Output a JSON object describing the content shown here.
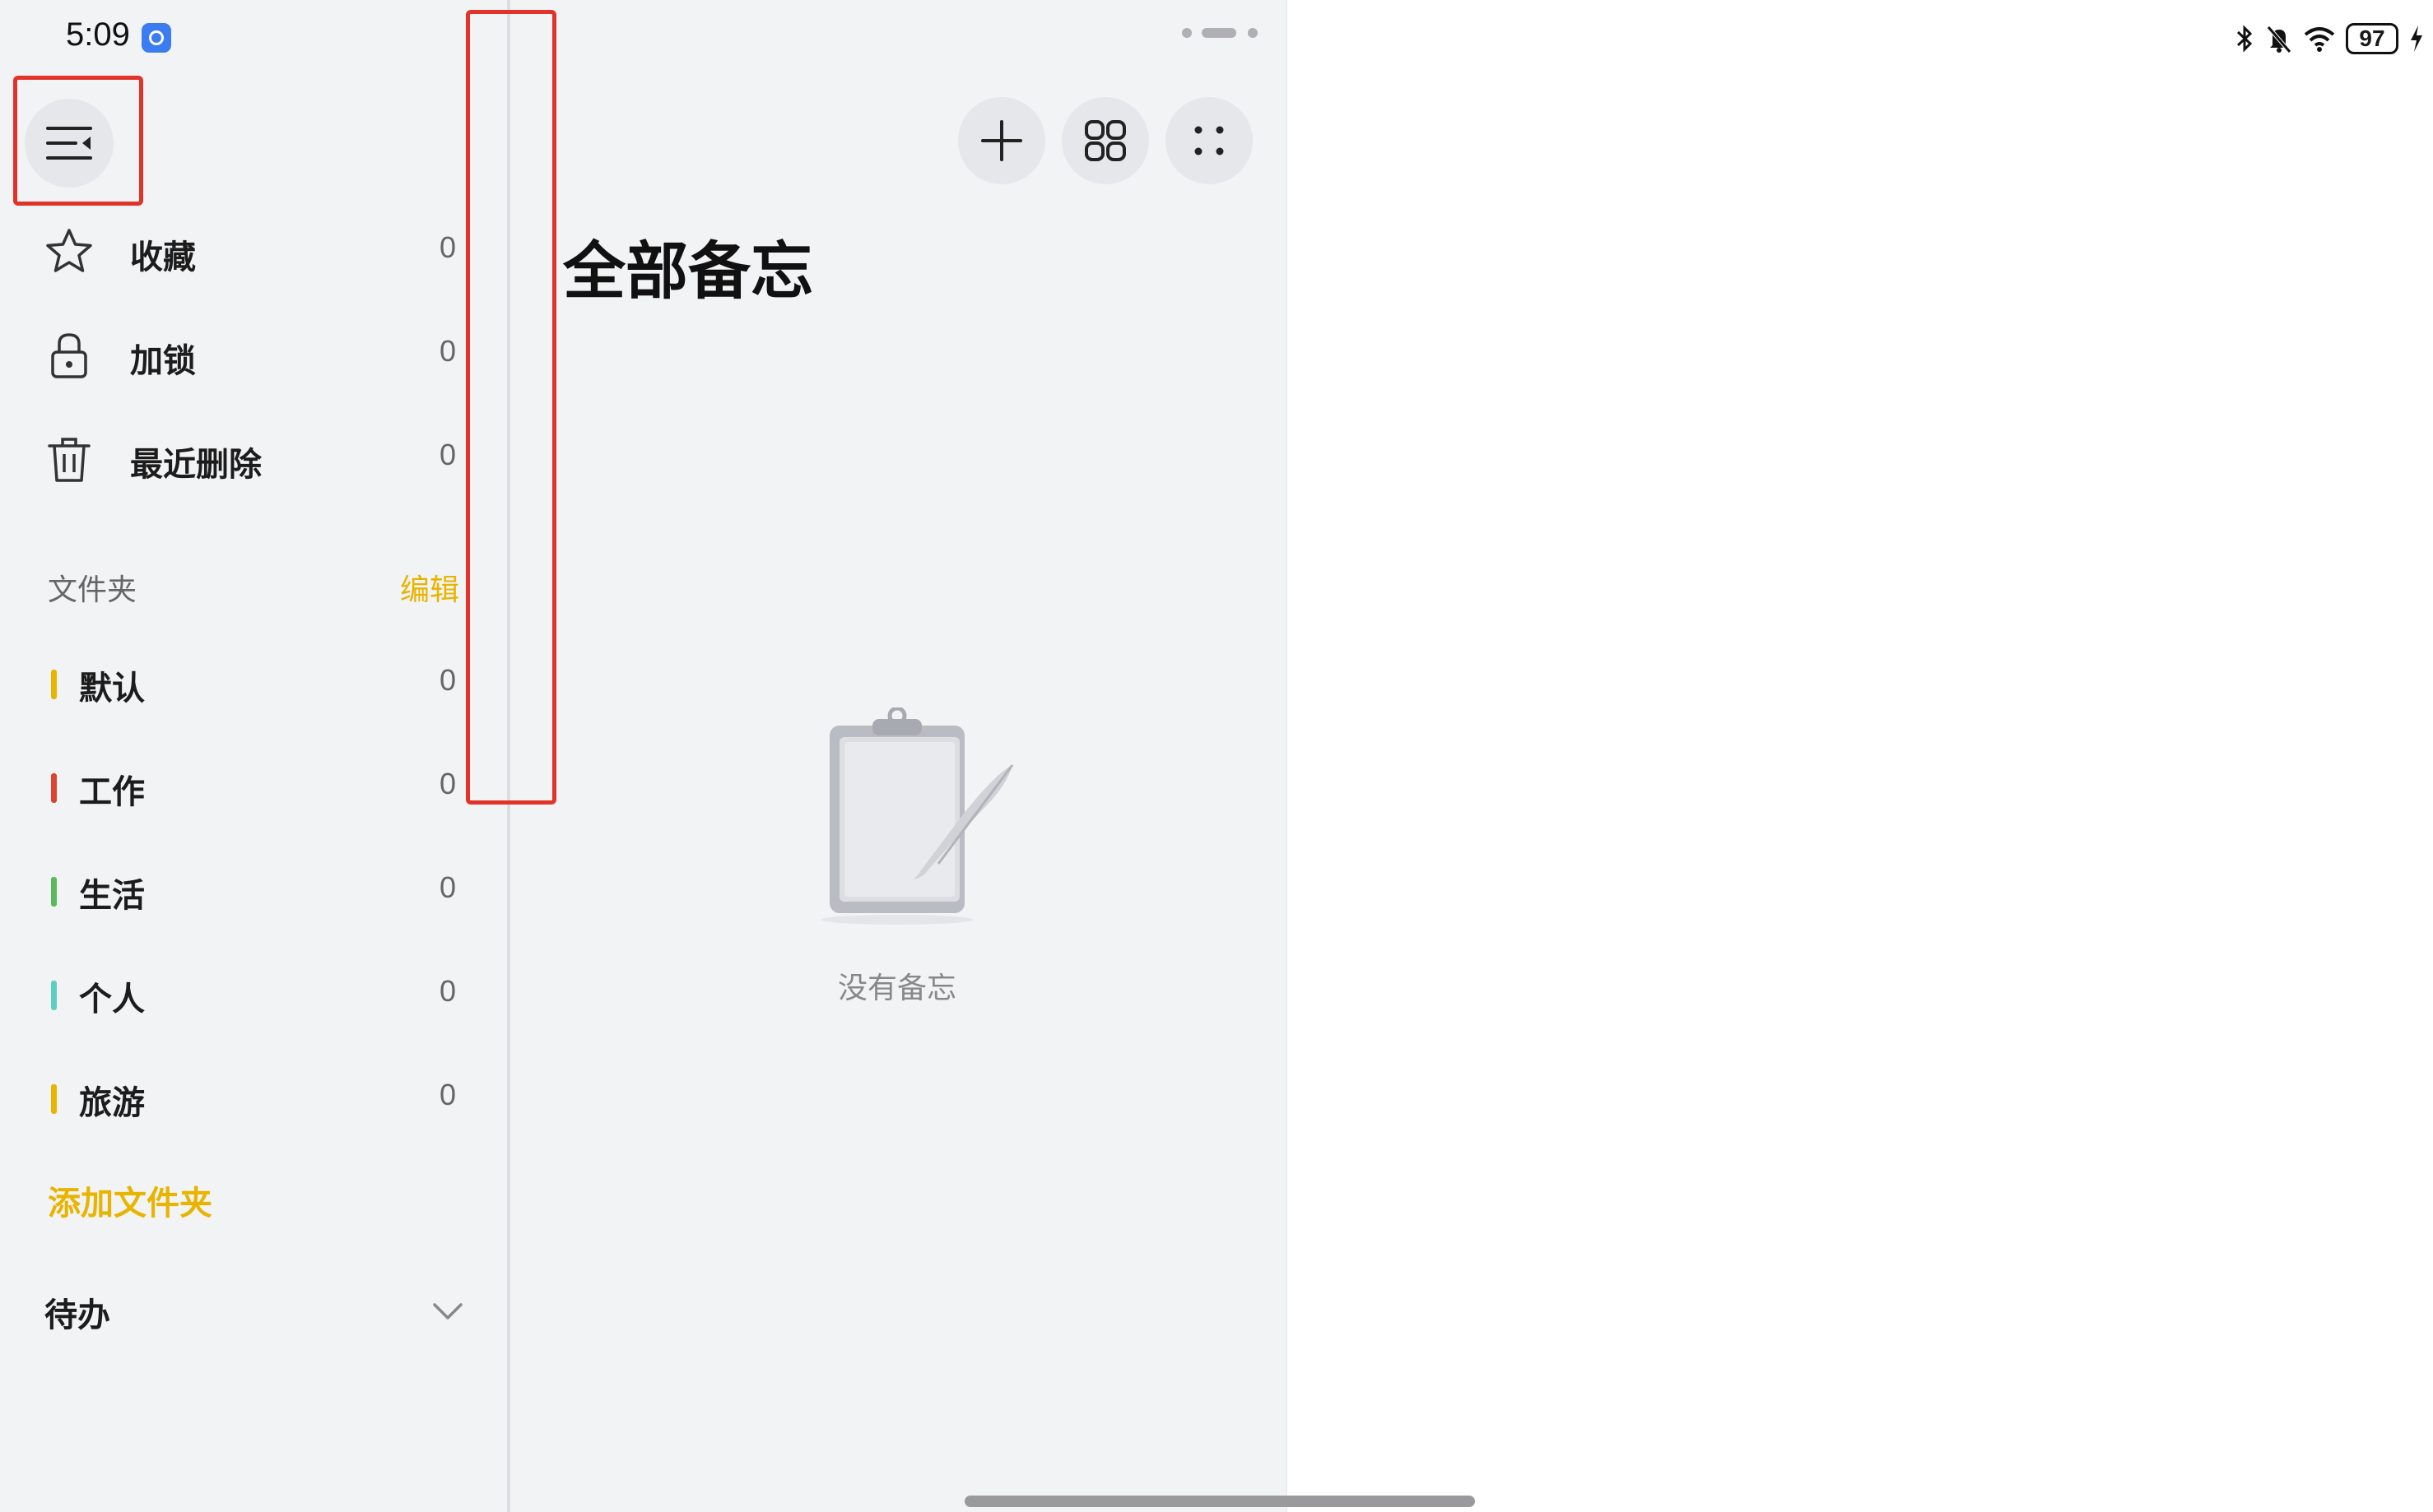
{
  "status_bar": {
    "time": "5:09",
    "battery": "97",
    "icons": [
      "bluetooth-icon",
      "mute-icon",
      "wifi-icon",
      "battery-icon",
      "charging-icon"
    ]
  },
  "sidebar": {
    "menu_icon": "sidebar-toggle-icon",
    "items": [
      {
        "label": "收藏",
        "count": "0",
        "icon": "star-icon"
      },
      {
        "label": "加锁",
        "count": "0",
        "icon": "lock-icon"
      },
      {
        "label": "最近删除",
        "count": "0",
        "icon": "trash-icon"
      }
    ],
    "folders_title": "文件夹",
    "folders_edit": "编辑",
    "folders": [
      {
        "label": "默认",
        "count": "0",
        "color": "#e8b400"
      },
      {
        "label": "工作",
        "count": "0",
        "color": "#d9432f"
      },
      {
        "label": "生活",
        "count": "0",
        "color": "#5cb85c"
      },
      {
        "label": "个人",
        "count": "0",
        "color": "#5ccfc0"
      },
      {
        "label": "旅游",
        "count": "0",
        "color": "#e8b400"
      }
    ],
    "add_folder": "添加文件夹",
    "todo": "待办"
  },
  "main": {
    "title": "全部备忘",
    "empty_text": "没有备忘",
    "toolbar": [
      "add-icon",
      "grid-view-icon",
      "more-icon"
    ]
  },
  "colors": {
    "accent": "#e8b400",
    "annotation": "#e0342a"
  }
}
